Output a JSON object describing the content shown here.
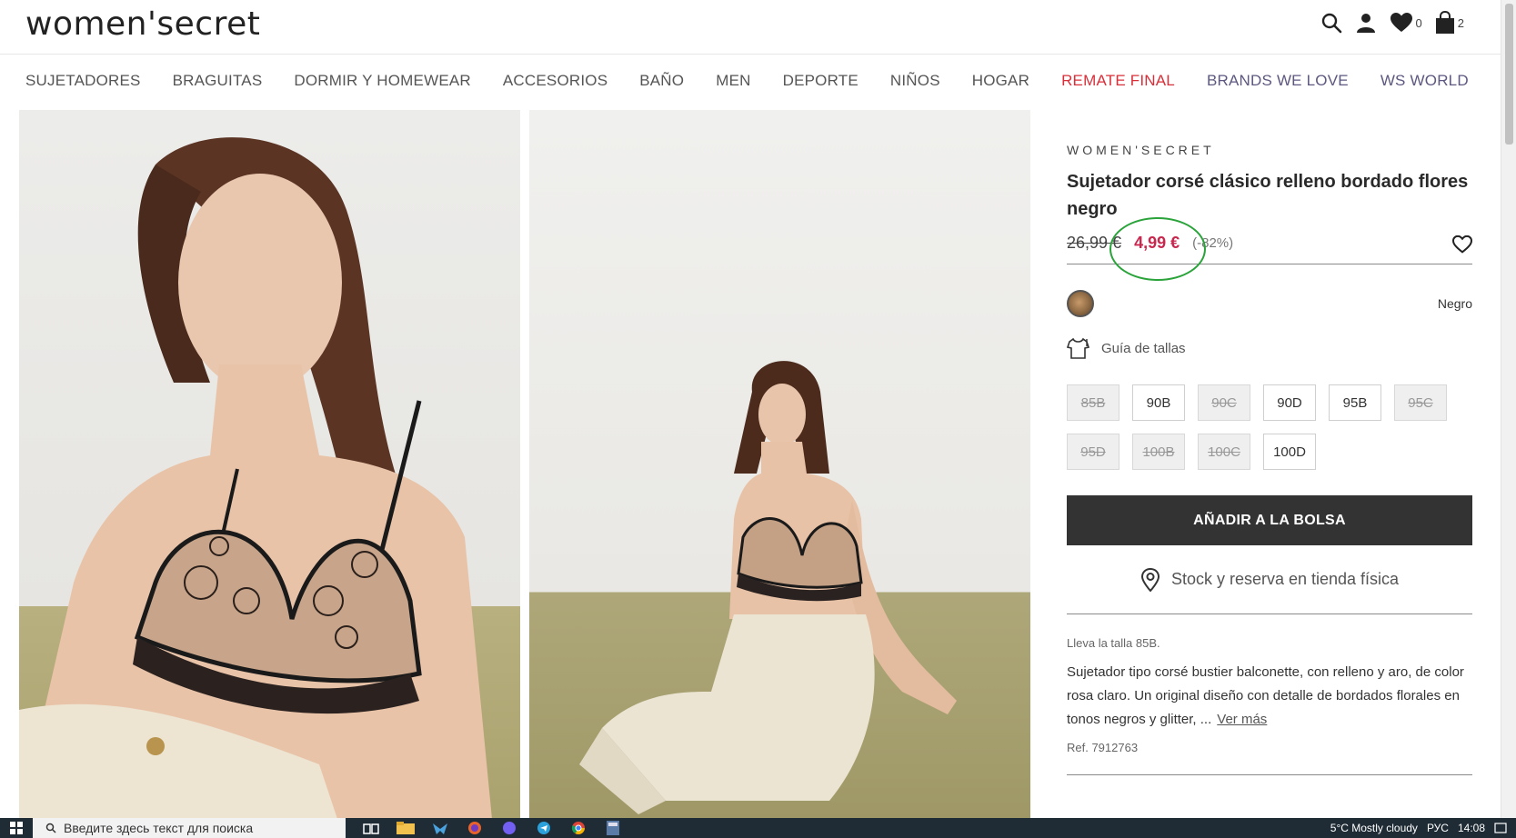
{
  "header": {
    "logo": "women'secret",
    "wishlist_count": "0",
    "bag_count": "2"
  },
  "nav": {
    "items": [
      {
        "label": "SUJETADORES"
      },
      {
        "label": "BRAGUITAS"
      },
      {
        "label": "DORMIR Y HOMEWEAR"
      },
      {
        "label": "ACCESORIOS"
      },
      {
        "label": "BAÑO"
      },
      {
        "label": "MEN"
      },
      {
        "label": "DEPORTE"
      },
      {
        "label": "NIÑOS"
      },
      {
        "label": "HOGAR"
      },
      {
        "label": "REMATE FINAL"
      },
      {
        "label": "BRANDS WE LOVE"
      },
      {
        "label": "WS WORLD"
      }
    ],
    "colors": {
      "remate": "#d8303a",
      "brands": "#5d5880"
    }
  },
  "product": {
    "brand": "WOMEN'SECRET",
    "title": "Sujetador corsé clásico relleno bordado flores negro",
    "old_price": "26,99 €",
    "new_price": "4,99 €",
    "discount": "(-82%)",
    "color_name": "Negro",
    "size_guide": "Guía de tallas",
    "sizes": [
      {
        "label": "85B",
        "available": false
      },
      {
        "label": "90B",
        "available": true
      },
      {
        "label": "90C",
        "available": false
      },
      {
        "label": "90D",
        "available": true
      },
      {
        "label": "95B",
        "available": true
      },
      {
        "label": "95C",
        "available": false
      },
      {
        "label": "95D",
        "available": false
      },
      {
        "label": "100B",
        "available": false
      },
      {
        "label": "100C",
        "available": false
      },
      {
        "label": "100D",
        "available": true
      }
    ],
    "add_to_bag": "AÑADIR A LA BOLSA",
    "stock_label": "Stock y reserva en tienda física",
    "model_size": "Lleva la talla 85B.",
    "description": "Sujetador tipo corsé bustier balconette, con relleno y aro, de color rosa claro. Un original diseño con detalle de bordados florales en tonos negros y glitter, ...",
    "see_more": "Ver más",
    "ref": "Ref. 7912763",
    "price_color": "#c8274e"
  },
  "taskbar": {
    "search_placeholder": "Введите здесь текст для поиска",
    "weather": "5°C  Mostly cloudy",
    "lang": "РУС",
    "time": "14:08"
  }
}
